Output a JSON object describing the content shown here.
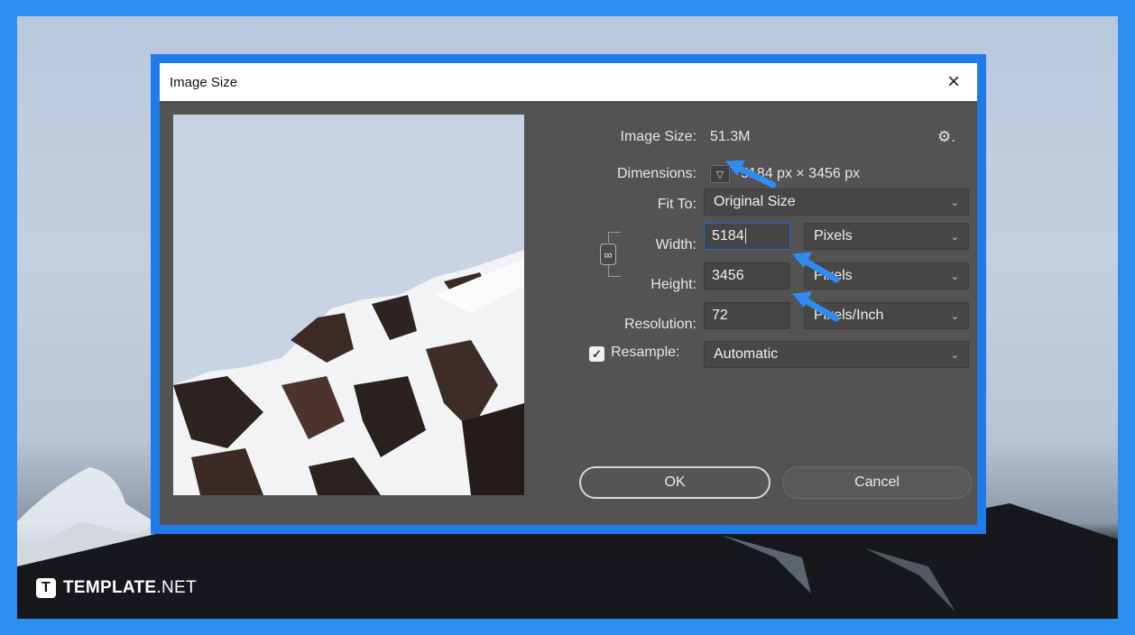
{
  "brand": {
    "icon_letter": "T",
    "name_bold": "TEMPLATE",
    "name_suffix": ".NET"
  },
  "dialog": {
    "title": "Image Size",
    "close_icon": "×",
    "image_size_label": "Image Size:",
    "image_size_value": "51.3M",
    "gear_icon": "⚙.",
    "dimensions_label": "Dimensions:",
    "dimensions_value": "5184 px  ×  3456 px",
    "fit_to_label": "Fit To:",
    "fit_to_value": "Original Size",
    "width_label": "Width:",
    "width_value": "5184",
    "width_unit": "Pixels",
    "height_label": "Height:",
    "height_value": "3456",
    "height_unit": "Pixels",
    "resolution_label": "Resolution:",
    "resolution_value": "72",
    "resolution_unit": "Pixels/Inch",
    "resample_label": "Resample:",
    "resample_checked": true,
    "resample_value": "Automatic",
    "ok_label": "OK",
    "cancel_label": "Cancel"
  },
  "colors": {
    "frame_blue": "#1f7be8",
    "dialog_bg": "#535353",
    "arrow_blue": "#2f8cf2"
  }
}
